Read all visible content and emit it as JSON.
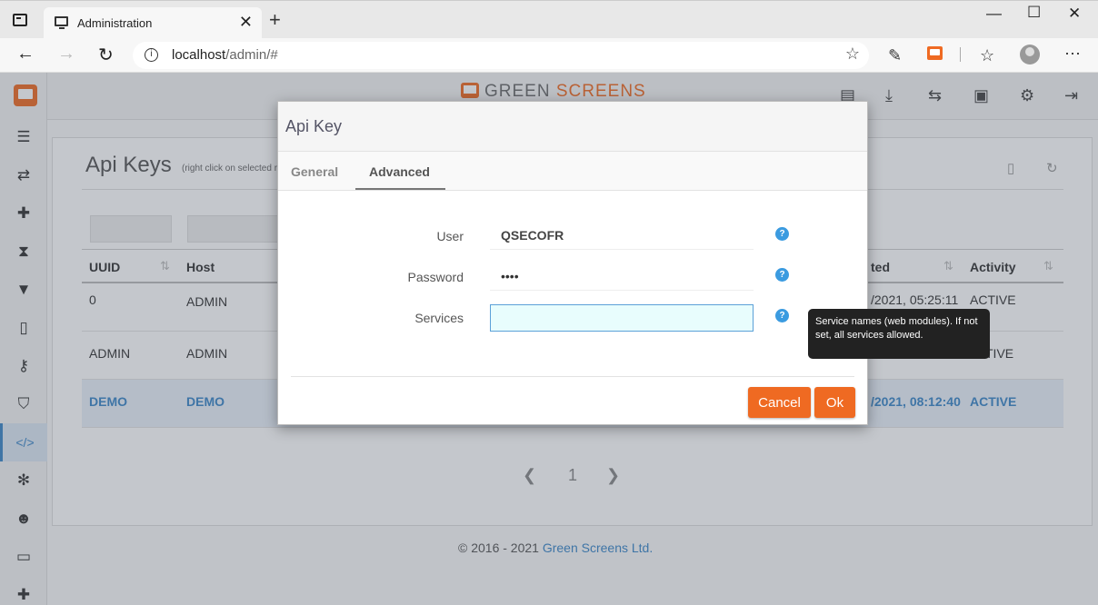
{
  "browser": {
    "tab_title": "Administration",
    "tab_close": "✕",
    "new_tab": "+",
    "minimize": "—",
    "maximize": "☐",
    "close": "✕",
    "back": "←",
    "forward": "→",
    "reload": "↻",
    "url_host": "localhost",
    "url_path": "/admin/#",
    "info": "i",
    "favorites_add": "☆",
    "reading": "✎",
    "collections": "☆",
    "more": "⋯"
  },
  "header": {
    "brand_part1": "GREEN ",
    "brand_part2": "SCREENS"
  },
  "sidebar": {
    "items": [
      {
        "icon": "list-icon",
        "glyph": "☰"
      },
      {
        "icon": "transfer-icon",
        "glyph": "⇄"
      },
      {
        "icon": "puzzle-icon",
        "glyph": "✚"
      },
      {
        "icon": "hourglass-icon",
        "glyph": "⧗"
      },
      {
        "icon": "filter-icon",
        "glyph": "▼"
      },
      {
        "icon": "mobile-icon",
        "glyph": "▯"
      },
      {
        "icon": "key-icon",
        "glyph": "⚷"
      },
      {
        "icon": "shield-icon",
        "glyph": "⛉"
      },
      {
        "icon": "code-icon",
        "glyph": "</>"
      },
      {
        "icon": "snowflake-icon",
        "glyph": "✻"
      },
      {
        "icon": "users-icon",
        "glyph": "☻"
      },
      {
        "icon": "desktop-icon",
        "glyph": "▭"
      },
      {
        "icon": "puzzle-icon",
        "glyph": "✚"
      }
    ]
  },
  "topnav": {
    "icons": [
      {
        "icon": "terminal-icon",
        "glyph": "▤"
      },
      {
        "icon": "download-icon",
        "glyph": "⤓"
      },
      {
        "icon": "retweet-icon",
        "glyph": "⇆"
      },
      {
        "icon": "id-card-icon",
        "glyph": "▣"
      },
      {
        "icon": "cogs-icon",
        "glyph": "⚙"
      },
      {
        "icon": "sign-out-icon",
        "glyph": "⇥"
      }
    ]
  },
  "panel": {
    "title": "Api Keys",
    "subtitle": "(right click on selected ro",
    "tool_new": "▯",
    "tool_refresh": "↻",
    "columns": {
      "uuid": "UUID",
      "host": "Host",
      "updated": "ted",
      "activity": "Activity"
    },
    "sort_glyph": "⇅",
    "rows": [
      {
        "uuid": "0",
        "host": "ADMIN",
        "updated": "/2021, 05:25:11",
        "activity": "ACTIVE"
      },
      {
        "uuid": "ADMIN",
        "host": "ADMIN",
        "updated": "",
        "activity": "TIVE"
      },
      {
        "uuid": "DEMO",
        "host": "DEMO",
        "updated": "/2021, 08:12:40",
        "activity": "ACTIVE"
      }
    ],
    "pager_prev": "❮",
    "pager_page": "1",
    "pager_next": "❯"
  },
  "footer": {
    "copyright": "© 2016 - 2021 ",
    "company": "Green Screens Ltd."
  },
  "modal": {
    "title": "Api Key",
    "tabs": [
      "General",
      "Advanced"
    ],
    "active_tab": "Advanced",
    "fields": {
      "user_label": "User",
      "user_value": "QSECOFR",
      "password_label": "Password",
      "password_value": "••••",
      "services_label": "Services",
      "services_value": ""
    },
    "help_glyph": "?",
    "cancel_label": "Cancel",
    "ok_label": "Ok",
    "tooltip": "Service names (web modules). If not set, all services allowed."
  },
  "colors": {
    "accent": "#ef6a22",
    "link": "#3b86c8",
    "help": "#3b9be0"
  }
}
